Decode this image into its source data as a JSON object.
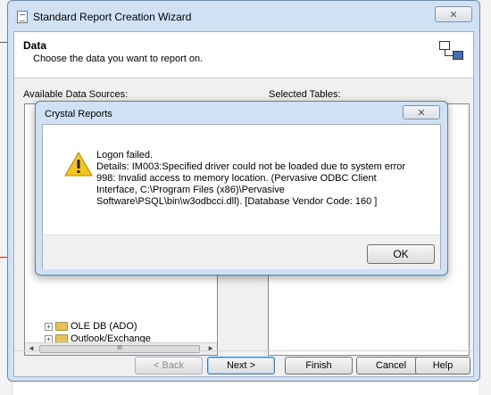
{
  "wizard": {
    "title": "Standard Report Creation Wizard",
    "close_glyph": "✕",
    "header": {
      "title": "Data",
      "subtitle": "Choose the data you want to report on."
    },
    "available_label": "Available Data Sources:",
    "selected_label": "Selected Tables:",
    "tree_items": [
      {
        "expander": "+",
        "label": "OLE DB (ADO)"
      },
      {
        "expander": "+",
        "label": "Outlook/Exchange"
      }
    ],
    "scroll_left": "◄",
    "scroll_right": "►",
    "scroll_down": "▼",
    "scroll_thumb_grip": "III",
    "buttons": {
      "back": "< Back",
      "next": "Next >",
      "finish": "Finish",
      "cancel": "Cancel",
      "help": "Help"
    }
  },
  "dialog": {
    "title": "Crystal Reports",
    "close_glyph": "✕",
    "message_lines": [
      "Logon failed.",
      "Details: IM003:Specified driver could not be loaded due to system error",
      "998: Invalid access to memory location. (Pervasive ODBC Client",
      "Interface, C:\\Program Files (x86)\\Pervasive",
      "Software\\PSQL\\bin\\w3odbcci.dll). [Database Vendor Code: 160 ]"
    ],
    "ok_label": "OK",
    "icon": "warning-icon"
  },
  "colors": {
    "frame": "#cfe1f3",
    "warning": "#f5c518"
  }
}
